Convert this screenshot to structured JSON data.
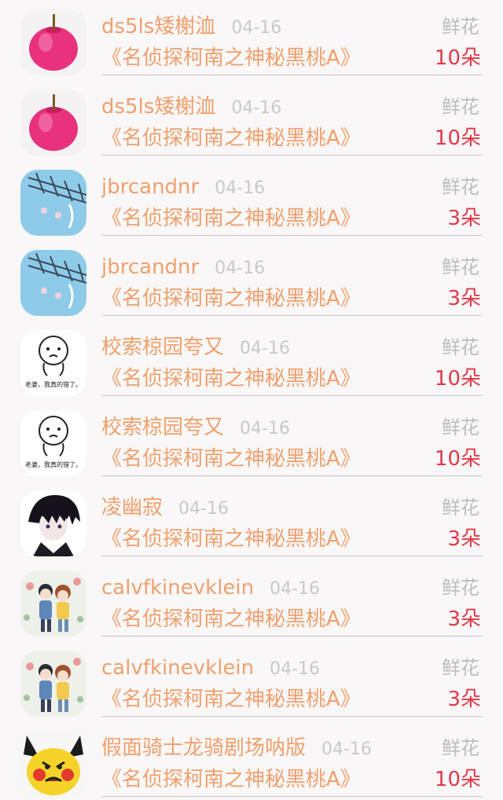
{
  "rows": [
    {
      "user": "ds5ls矮榭洫",
      "date": "04-16",
      "title": "《名侦探柯南之神秘黑桃A》",
      "gift": "鲜花",
      "count": "10朵",
      "avatar": "apple-avatar"
    },
    {
      "user": "ds5ls矮榭洫",
      "date": "04-16",
      "title": "《名侦探柯南之神秘黑桃A》",
      "gift": "鲜花",
      "count": "10朵",
      "avatar": "apple-avatar"
    },
    {
      "user": "jbrcandnr",
      "date": "04-16",
      "title": "《名侦探柯南之神秘黑桃A》",
      "gift": "鲜花",
      "count": "3朵",
      "avatar": "wind-chime-avatar"
    },
    {
      "user": "jbrcandnr",
      "date": "04-16",
      "title": "《名侦探柯南之神秘黑桃A》",
      "gift": "鲜花",
      "count": "3朵",
      "avatar": "wind-chime-avatar"
    },
    {
      "user": "校索椋园夸又",
      "date": "04-16",
      "title": "《名侦探柯南之神秘黑桃A》",
      "gift": "鲜花",
      "count": "10朵",
      "avatar": "cartoon-sad-avatar",
      "avatar_caption": "老婆，我真的错了。"
    },
    {
      "user": "校索椋园夸又",
      "date": "04-16",
      "title": "《名侦探柯南之神秘黑桃A》",
      "gift": "鲜花",
      "count": "10朵",
      "avatar": "cartoon-sad-avatar",
      "avatar_caption": "老婆，我真的错了。"
    },
    {
      "user": "凌幽寂",
      "date": "04-16",
      "title": "《名侦探柯南之神秘黑桃A》",
      "gift": "鲜花",
      "count": "3朵",
      "avatar": "anime-boy-avatar"
    },
    {
      "user": "calvfkinevklein",
      "date": "04-16",
      "title": "《名侦探柯南之神秘黑桃A》",
      "gift": "鲜花",
      "count": "3朵",
      "avatar": "couple-avatar"
    },
    {
      "user": "calvfkinevklein",
      "date": "04-16",
      "title": "《名侦探柯南之神秘黑桃A》",
      "gift": "鲜花",
      "count": "3朵",
      "avatar": "couple-avatar"
    },
    {
      "user": "假面骑士龙骑剧场呐版",
      "date": "04-16",
      "title": "《名侦探柯南之神秘黑桃A》",
      "gift": "鲜花",
      "count": "10朵",
      "avatar": "pikachu-avatar"
    }
  ],
  "colors": {
    "username": "#f0a06e",
    "date": "#c9c9c9",
    "gift_label": "#bdbdbd",
    "count": "#e03a4a",
    "background": "#f9f7f7"
  }
}
